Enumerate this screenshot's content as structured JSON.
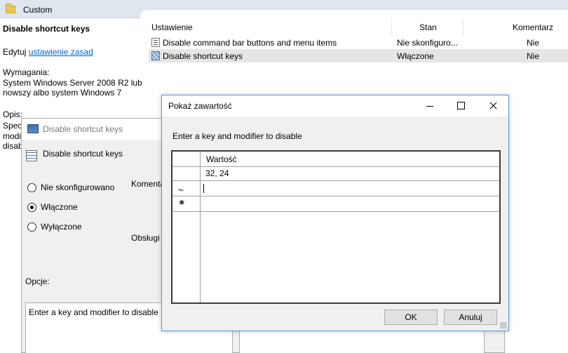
{
  "header": {
    "folder_title": "Custom"
  },
  "left_panel": {
    "setting_title": "Disable shortcut keys",
    "edit_prefix": "Edytuj ",
    "edit_link": "ustawienie zasad ",
    "requirements_label": "Wymagania:",
    "requirements_line1": "System Windows Server 2008 R2 lub",
    "requirements_line2": "nowszy albo system Windows 7",
    "description_label": "Opis:",
    "description_fragments": [
      "Speci",
      "modi",
      "disab"
    ]
  },
  "list": {
    "columns": {
      "setting": "Ustawienie",
      "state": "Stan",
      "comment": "Komentarz"
    },
    "rows": [
      {
        "name": "Disable command bar buttons and menu items",
        "state": "Nie skonfiguro...",
        "comment": "Nie"
      },
      {
        "name": "Disable shortcut keys",
        "state": "Włączone",
        "comment": "Nie"
      }
    ]
  },
  "policy_dialog": {
    "title": "Disable shortcut keys",
    "header": "Disable shortcut keys",
    "options": {
      "not_configured": "Nie skonfigurowano",
      "enabled": "Włączone",
      "disabled": "Wyłączone"
    },
    "selected": "enabled",
    "comment_label": "Komenta",
    "supported_label": "Obsługi",
    "options_label": "Opcje:",
    "options_text": "Enter a key and modifier to disable"
  },
  "show_contents_dialog": {
    "title": "Pokaż zawartość",
    "prompt": "Enter a key and modifier to disable",
    "column_header": "Wartość",
    "values": [
      "32, 24"
    ],
    "ok_label": "OK",
    "cancel_label": "Anuluj"
  }
}
